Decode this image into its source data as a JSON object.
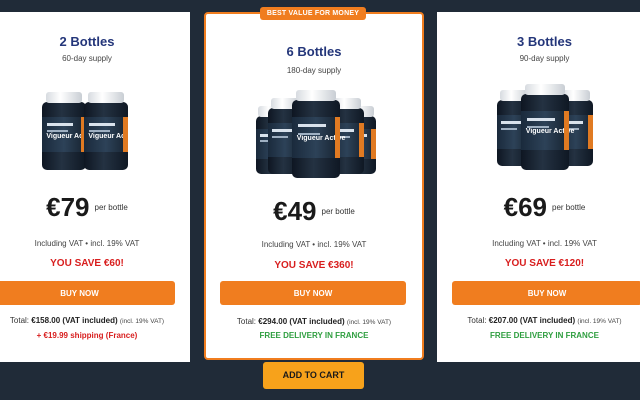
{
  "badge": "BEST VALUE FOR MONEY",
  "product_name": "Vigueur Active",
  "offers": [
    {
      "title": "2 Bottles",
      "supply": "60-day supply",
      "price": "€79",
      "per_label": "per bottle",
      "vat": "Including VAT • incl. 19% VAT",
      "save": "YOU SAVE €60!",
      "buy_label": "BUY NOW",
      "total_prefix": "Total:",
      "total_value": "€158.00 (VAT included)",
      "total_note": "(incl. 19% VAT)",
      "shipping": "+ €19.99 shipping (France)"
    },
    {
      "title": "6 Bottles",
      "supply": "180-day supply",
      "price": "€49",
      "per_label": "per bottle",
      "vat": "Including VAT • incl. 19% VAT",
      "save": "YOU SAVE €360!",
      "buy_label": "BUY NOW",
      "total_prefix": "Total:",
      "total_value": "€294.00 (VAT included)",
      "total_note": "(incl. 19% VAT)",
      "shipping": "FREE DELIVERY IN FRANCE"
    },
    {
      "title": "3 Bottles",
      "supply": "90-day supply",
      "price": "€69",
      "per_label": "per bottle",
      "vat": "Including VAT • incl. 19% VAT",
      "save": "YOU SAVE €120!",
      "buy_label": "BUY NOW",
      "total_prefix": "Total:",
      "total_value": "€207.00 (VAT included)",
      "total_note": "(incl. 19% VAT)",
      "shipping": "FREE DELIVERY IN FRANCE"
    }
  ],
  "cart_label": "ADD TO CART",
  "colors": {
    "background": "#202b38",
    "accent": "#f07d1f",
    "cart_button": "#f7a21b",
    "title": "#24367a",
    "save": "#d81e1e",
    "free_delivery": "#2e9e3f"
  }
}
